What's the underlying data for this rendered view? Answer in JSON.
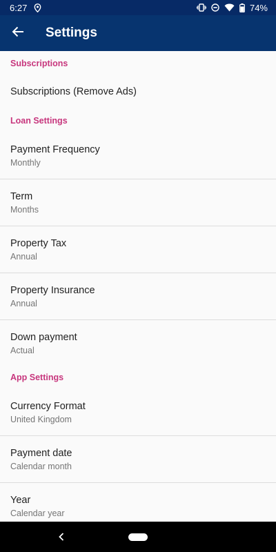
{
  "status": {
    "time": "6:27",
    "battery": "74%"
  },
  "app_bar": {
    "title": "Settings"
  },
  "sections": {
    "subscriptions": {
      "header": "Subscriptions",
      "items": [
        {
          "title": "Subscriptions (Remove Ads)"
        }
      ]
    },
    "loan": {
      "header": "Loan Settings",
      "items": [
        {
          "title": "Payment Frequency",
          "value": "Monthly"
        },
        {
          "title": "Term",
          "value": "Months"
        },
        {
          "title": "Property Tax",
          "value": "Annual"
        },
        {
          "title": "Property Insurance",
          "value": "Annual"
        },
        {
          "title": "Down payment",
          "value": "Actual"
        }
      ]
    },
    "app": {
      "header": "App Settings",
      "items": [
        {
          "title": "Currency Format",
          "value": "United Kingdom"
        },
        {
          "title": "Payment date",
          "value": "Calendar month"
        },
        {
          "title": "Year",
          "value": "Calendar year"
        }
      ]
    }
  },
  "colors": {
    "app_bar": "#07346f",
    "status_bar": "#072a66",
    "section_header": "#c7367d"
  },
  "icons": {
    "back": "arrow-left-icon",
    "location": "location-pin-icon",
    "vibrate": "vibrate-icon",
    "dnd": "do-not-disturb-icon",
    "wifi": "wifi-icon",
    "battery": "battery-icon"
  }
}
